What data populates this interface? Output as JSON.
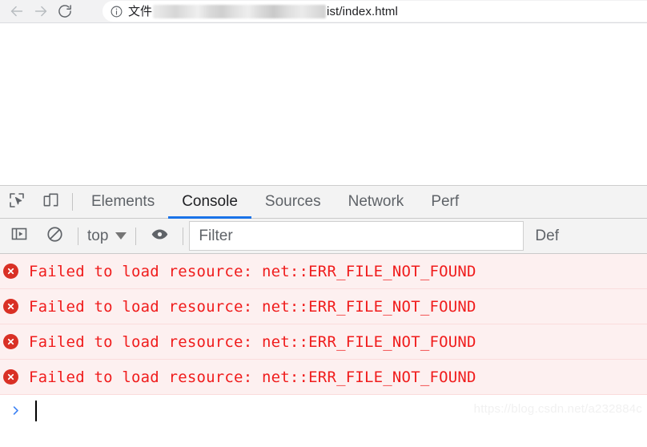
{
  "browser": {
    "nav": {
      "back_icon": "arrow-left-icon",
      "forward_icon": "arrow-right-icon",
      "reload_icon": "reload-icon"
    },
    "omnibox": {
      "security_icon": "info-circle-icon",
      "url_prefix": "文件",
      "url_redacted": true,
      "url_suffix": "ist/index.html"
    }
  },
  "devtools": {
    "toolbar_icons": {
      "inspect": "inspect-cursor-icon",
      "device": "device-toggle-icon"
    },
    "tabs": [
      {
        "label": "Elements",
        "active": false
      },
      {
        "label": "Console",
        "active": true
      },
      {
        "label": "Sources",
        "active": false
      },
      {
        "label": "Network",
        "active": false
      },
      {
        "label": "Perf",
        "active": false
      }
    ],
    "active_tab": "Console",
    "accent_color": "#1a73e8",
    "filter_bar": {
      "sidebar_icon": "console-sidebar-icon",
      "clear_icon": "clear-console-icon",
      "context": "top",
      "context_caret_icon": "chevron-down-icon",
      "eye_icon": "live-expression-eye-icon",
      "filter_value": "",
      "filter_placeholder": "Filter",
      "levels_label": "Def"
    },
    "console": {
      "messages": [
        {
          "level": "error",
          "icon": "error-circle-icon",
          "text": "Failed to load resource: net::ERR_FILE_NOT_FOUND"
        },
        {
          "level": "error",
          "icon": "error-circle-icon",
          "text": "Failed to load resource: net::ERR_FILE_NOT_FOUND"
        },
        {
          "level": "error",
          "icon": "error-circle-icon",
          "text": "Failed to load resource: net::ERR_FILE_NOT_FOUND"
        },
        {
          "level": "error",
          "icon": "error-circle-icon",
          "text": "Failed to load resource: net::ERR_FILE_NOT_FOUND"
        }
      ],
      "error_color": "#f01c1c",
      "error_row_bg": "#fdf0f0",
      "prompt_icon": "prompt-chevron-icon",
      "prompt_value": ""
    }
  },
  "watermark": {
    "text": "https://blog.csdn.net/a232884c"
  }
}
